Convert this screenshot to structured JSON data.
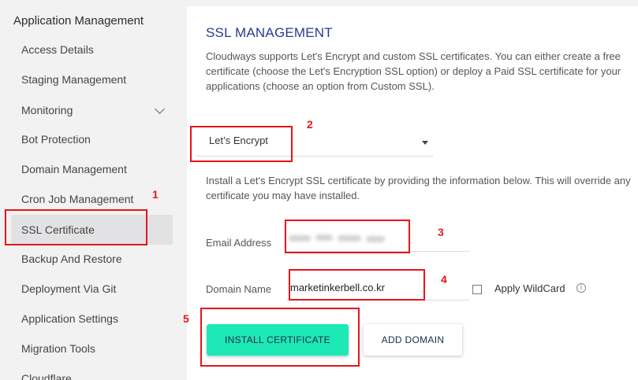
{
  "sidebar": {
    "title": "Application Management",
    "items": [
      {
        "label": "Access Details"
      },
      {
        "label": "Staging Management"
      },
      {
        "label": "Monitoring"
      },
      {
        "label": "Bot Protection"
      },
      {
        "label": "Domain Management"
      },
      {
        "label": "Cron Job Management"
      },
      {
        "label": "SSL Certificate"
      },
      {
        "label": "Backup And Restore"
      },
      {
        "label": "Deployment Via Git"
      },
      {
        "label": "Application Settings"
      },
      {
        "label": "Migration Tools"
      },
      {
        "label": "Cloudflare"
      }
    ]
  },
  "main": {
    "title": "SSL MANAGEMENT",
    "description": "Cloudways supports Let's Encrypt and custom SSL certificates. You can either create a free certificate (choose the Let's Encryption SSL option) or deploy a Paid SSL certificate for your applications (choose an option from Custom SSL).",
    "ssl_type_selected": "Let’s Encrypt",
    "install_description": "Install a Let's Encrypt SSL certificate by providing the information below. This will override any certificate you may have installed.",
    "email_label": "Email Address",
    "domain_label": "Domain Name",
    "domain_value": "marketinkerbell.co.kr",
    "wildcard_label": "Apply WildCard",
    "install_button": "INSTALL CERTIFICATE",
    "add_domain_button": "ADD DOMAIN"
  },
  "annotations": [
    "1",
    "2",
    "3",
    "4",
    "5"
  ],
  "colors": {
    "accent_title": "#2b3990",
    "primary_button": "#1de9b6",
    "annotation_red": "#e8141b",
    "sidebar_bg": "#f2f2f2",
    "active_item_bg": "#e2e2e4"
  }
}
